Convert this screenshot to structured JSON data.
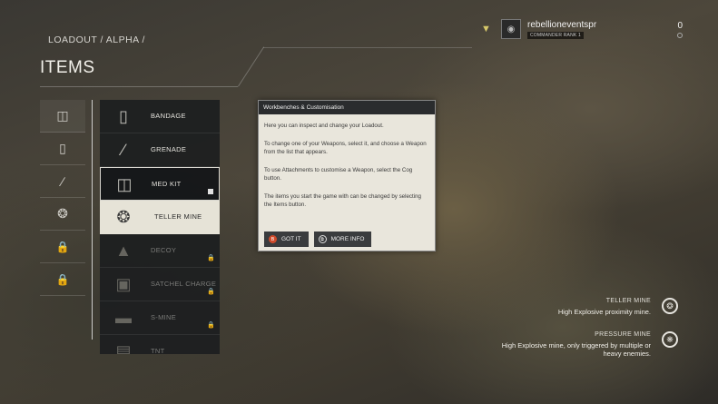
{
  "header": {
    "breadcrumb": "LOADOUT / ALPHA /",
    "title": "ITEMS"
  },
  "user": {
    "name": "rebellioneventspr",
    "rank_badge": "COMMANDER RANK 1",
    "count": "0"
  },
  "categories": [
    {
      "icon": "medkit-icon",
      "locked": false,
      "active": true
    },
    {
      "icon": "bandage-icon",
      "locked": false,
      "active": false
    },
    {
      "icon": "knife-icon",
      "locked": false,
      "active": false
    },
    {
      "icon": "mine-icon",
      "locked": false,
      "active": false
    },
    {
      "icon": "lock-icon",
      "locked": true,
      "active": false
    },
    {
      "icon": "lock-icon",
      "locked": true,
      "active": false
    }
  ],
  "items": [
    {
      "label": "BANDAGE",
      "state": "normal"
    },
    {
      "label": "GRENADE",
      "state": "normal"
    },
    {
      "label": "MED KIT",
      "state": "selected"
    },
    {
      "label": "TELLER MINE",
      "state": "highlight"
    },
    {
      "label": "DECOY",
      "state": "locked"
    },
    {
      "label": "SATCHEL CHARGE",
      "state": "locked"
    },
    {
      "label": "S-MINE",
      "state": "locked"
    },
    {
      "label": "TNT",
      "state": "locked"
    }
  ],
  "dialog": {
    "title": "Workbenches & Customisation",
    "p1": "Here you can inspect and change your Loadout.",
    "p2": "To change one of your Weapons, select it, and choose a Weapon from the list that appears.",
    "p3": "To use Attachments to customise a Weapon, select the Cog button.",
    "p4": "The items you start the game with can be changed by selecting the Items button.",
    "got_it": "GOT IT",
    "got_it_key": "B",
    "more_info": "MORE INFO"
  },
  "info": {
    "teller_name": "TELLER MINE",
    "teller_desc": "High Explosive proximity mine.",
    "pressure_name": "PRESSURE MINE",
    "pressure_desc": "High Explosive mine, only triggered by multiple or heavy enemies."
  }
}
